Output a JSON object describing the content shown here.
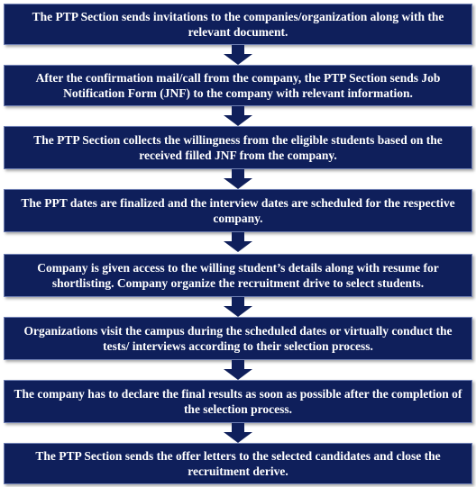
{
  "colors": {
    "box_fill": "#0f1f5b",
    "arrow_fill": "#0f1f5b",
    "text": "#ffffff"
  },
  "steps": [
    "The PTP Section sends invitations to the companies/organization  along with the relevant document.",
    "After the confirmation  mail/call  from  the company, the PTP Section sends Job Notification Form  (JNF) to the company with  relevant information.",
    "The PTP Section collects the willingness from the eligible students based on the received filled JNF from the company.",
    "The PPT dates are finalized and the interview dates are scheduled for the respective company.",
    "Company  is given access to the willing  student’s details along with  resume for shortlisting. Company  organize  the recruitment drive to select students.",
    "Organizations  visit the campus  during  the scheduled dates or virtually conduct  the tests/ interviews according  to their selection process.",
    "The company has to declare the final results as soon as possible after the completion of the selection process.",
    "The PTP Section sends the offer letters to the selected candidates and close the recruitment  derive."
  ],
  "arrow_icon": "down-arrow-icon"
}
